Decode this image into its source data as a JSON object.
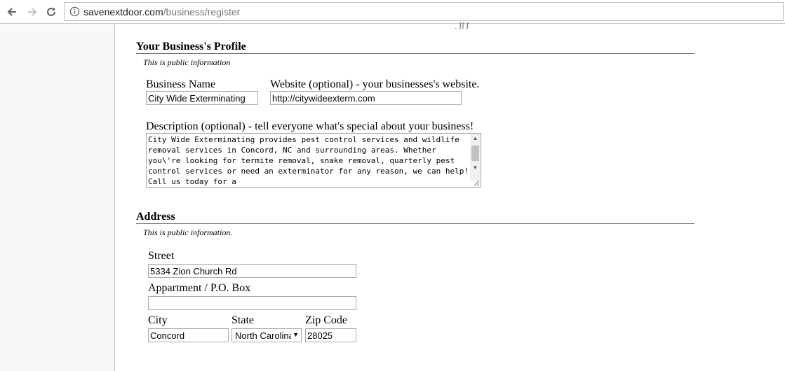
{
  "browser": {
    "url_host": "savenextdoor.com",
    "url_path": "/business/register"
  },
  "profile": {
    "title": "Your Business's Profile",
    "note": "This is public information",
    "name_label": "Business Name",
    "name_value": "City Wide Exterminating",
    "website_label": "Website (optional) - your businesses's website.",
    "website_value": "http://citywideexterm.com",
    "description_label": "Description (optional) - tell everyone what's special about your business!",
    "description_value": "City Wide Exterminating provides pest control services and wildlife removal services in Concord, NC and surrounding areas. Whether you\\'re looking for termite removal, snake removal, quarterly pest control services or need an exterminator for any reason, we can help! Call us today for a"
  },
  "address": {
    "title": "Address",
    "note": "This is public information.",
    "street_label": "Street",
    "street_value": "5334 Zion Church Rd",
    "apt_label": "Appartment / P.O. Box",
    "apt_value": "",
    "city_label": "City",
    "city_value": "Concord",
    "state_label": "State",
    "state_value": "North Carolina",
    "zip_label": "Zip Code",
    "zip_value": "28025"
  },
  "icons": {
    "back": "back-arrow-icon",
    "forward": "forward-arrow-icon",
    "reload": "reload-icon",
    "info": "info-icon"
  }
}
